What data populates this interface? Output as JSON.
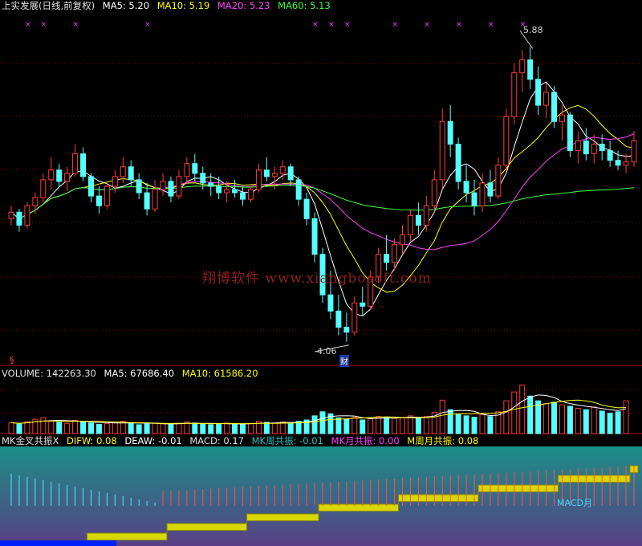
{
  "colors": {
    "up": "#ff3b3b",
    "down": "#54ffff",
    "ma5": "#ffffff",
    "ma10": "#ffff00",
    "ma20": "#ff40ff",
    "ma60": "#40ff40",
    "grid": "#8b0000",
    "frame": "#b00000",
    "label": "#d0d0d0",
    "watermark": "#8a2020",
    "macd_fill": "#d8d800",
    "blue_fill": "#0020ff"
  },
  "price_header": {
    "title": "上实发展(日线,前复权)",
    "ma5": "MA5: 5.20",
    "ma10": "MA10: 5.19",
    "ma20": "MA20: 5.23",
    "ma60": "MA60: 5.13"
  },
  "volume_header": {
    "title": "VOLUME: 142263.30",
    "ma5": "MA5: 67686.40",
    "ma10": "MA10: 61586.20"
  },
  "indicator_header": {
    "title": "MK金叉共振X",
    "difw": "DIFW: 0.08",
    "deaw": "DEAW: -0.01",
    "macd": "MACD: 0.17",
    "mk_week": "MK周共振: -0.01",
    "mk_month": "MK月共振: 0.00",
    "m_week_month": "M周月共振: 0.08"
  },
  "watermark": "翔博软件 www.xiangbosoft.com",
  "annotations": {
    "high_label": "5.88",
    "low_label": "4.06",
    "cai_badge": "财",
    "macd_month": "MACD月"
  },
  "chart_data": {
    "type": "candlestick",
    "title": "上实发展(日线,前复权)",
    "price_ylim": [
      3.92,
      6.1
    ],
    "high": 5.88,
    "low": 4.06,
    "ohlc": [
      [
        4.82,
        4.9,
        4.78,
        4.86
      ],
      [
        4.86,
        4.88,
        4.74,
        4.78
      ],
      [
        4.78,
        4.92,
        4.76,
        4.9
      ],
      [
        4.9,
        4.98,
        4.85,
        4.95
      ],
      [
        4.95,
        5.1,
        4.92,
        5.06
      ],
      [
        5.06,
        5.2,
        5.0,
        5.12
      ],
      [
        5.12,
        5.16,
        5.02,
        5.05
      ],
      [
        5.05,
        5.14,
        4.99,
        5.1
      ],
      [
        5.1,
        5.28,
        5.08,
        5.22
      ],
      [
        5.22,
        5.26,
        5.05,
        5.08
      ],
      [
        5.08,
        5.1,
        4.92,
        4.96
      ],
      [
        4.96,
        5.02,
        4.85,
        4.9
      ],
      [
        4.9,
        5.05,
        4.88,
        5.02
      ],
      [
        5.02,
        5.12,
        4.98,
        5.08
      ],
      [
        5.08,
        5.2,
        5.04,
        5.14
      ],
      [
        5.14,
        5.18,
        5.02,
        5.06
      ],
      [
        5.06,
        5.1,
        4.94,
        4.98
      ],
      [
        4.98,
        5.04,
        4.84,
        4.88
      ],
      [
        4.88,
        5.06,
        4.86,
        5.0
      ],
      [
        5.0,
        5.1,
        4.96,
        5.05
      ],
      [
        5.05,
        5.08,
        4.92,
        4.96
      ],
      [
        4.96,
        5.12,
        4.94,
        5.08
      ],
      [
        5.08,
        5.2,
        5.04,
        5.16
      ],
      [
        5.16,
        5.22,
        5.05,
        5.1
      ],
      [
        5.1,
        5.14,
        5.0,
        5.04
      ],
      [
        5.04,
        5.1,
        4.96,
        5.02
      ],
      [
        5.02,
        5.08,
        4.94,
        4.98
      ],
      [
        4.98,
        5.05,
        4.92,
        5.0
      ],
      [
        5.0,
        5.06,
        4.95,
        4.98
      ],
      [
        4.98,
        5.02,
        4.9,
        4.94
      ],
      [
        4.94,
        5.02,
        4.92,
        5.0
      ],
      [
        5.0,
        5.16,
        4.98,
        5.12
      ],
      [
        5.12,
        5.2,
        5.05,
        5.08
      ],
      [
        5.08,
        5.14,
        5.0,
        5.1
      ],
      [
        5.1,
        5.18,
        5.06,
        5.14
      ],
      [
        5.14,
        5.16,
        5.02,
        5.06
      ],
      [
        5.06,
        5.08,
        4.9,
        4.94
      ],
      [
        4.94,
        4.98,
        4.78,
        4.82
      ],
      [
        4.82,
        4.86,
        4.55,
        4.6
      ],
      [
        4.6,
        4.64,
        4.3,
        4.35
      ],
      [
        4.35,
        4.5,
        4.2,
        4.25
      ],
      [
        4.25,
        4.35,
        4.1,
        4.15
      ],
      [
        4.15,
        4.24,
        4.06,
        4.12
      ],
      [
        4.12,
        4.34,
        4.1,
        4.3
      ],
      [
        4.3,
        4.4,
        4.22,
        4.28
      ],
      [
        4.28,
        4.5,
        4.26,
        4.46
      ],
      [
        4.46,
        4.64,
        4.42,
        4.6
      ],
      [
        4.6,
        4.72,
        4.5,
        4.55
      ],
      [
        4.55,
        4.7,
        4.5,
        4.66
      ],
      [
        4.66,
        4.78,
        4.6,
        4.72
      ],
      [
        4.72,
        4.88,
        4.68,
        4.84
      ],
      [
        4.84,
        4.92,
        4.72,
        4.78
      ],
      [
        4.78,
        4.96,
        4.74,
        4.9
      ],
      [
        4.9,
        5.12,
        4.86,
        5.06
      ],
      [
        5.06,
        5.5,
        5.0,
        5.42
      ],
      [
        5.42,
        5.52,
        5.2,
        5.28
      ],
      [
        5.28,
        5.32,
        5.0,
        5.05
      ],
      [
        5.05,
        5.15,
        4.92,
        4.98
      ],
      [
        4.98,
        5.06,
        4.84,
        4.9
      ],
      [
        4.9,
        5.1,
        4.86,
        5.04
      ],
      [
        5.04,
        5.12,
        4.92,
        4.96
      ],
      [
        4.96,
        5.2,
        4.94,
        5.15
      ],
      [
        5.15,
        5.5,
        5.12,
        5.45
      ],
      [
        5.45,
        5.78,
        5.4,
        5.72
      ],
      [
        5.72,
        5.86,
        5.6,
        5.8
      ],
      [
        5.8,
        5.88,
        5.62,
        5.68
      ],
      [
        5.68,
        5.76,
        5.46,
        5.52
      ],
      [
        5.52,
        5.66,
        5.44,
        5.6
      ],
      [
        5.6,
        5.64,
        5.38,
        5.42
      ],
      [
        5.42,
        5.52,
        5.3,
        5.46
      ],
      [
        5.46,
        5.48,
        5.2,
        5.24
      ],
      [
        5.24,
        5.36,
        5.16,
        5.3
      ],
      [
        5.3,
        5.38,
        5.18,
        5.22
      ],
      [
        5.22,
        5.34,
        5.16,
        5.28
      ],
      [
        5.28,
        5.34,
        5.18,
        5.24
      ],
      [
        5.24,
        5.3,
        5.14,
        5.18
      ],
      [
        5.18,
        5.24,
        5.12,
        5.15
      ],
      [
        5.15,
        5.22,
        5.1,
        5.17
      ],
      [
        5.17,
        5.36,
        5.14,
        5.3
      ]
    ],
    "volume_ylim": [
      0,
      160000
    ],
    "volume": [
      32000,
      28000,
      35000,
      42000,
      46000,
      38000,
      33000,
      30000,
      39000,
      36000,
      31000,
      27000,
      29000,
      33000,
      36000,
      30000,
      26000,
      28000,
      31000,
      29000,
      27000,
      30000,
      34000,
      31000,
      28000,
      26000,
      29000,
      31000,
      28000,
      27000,
      30000,
      36000,
      33000,
      31000,
      34000,
      30000,
      36000,
      40000,
      52000,
      64000,
      58000,
      46000,
      42000,
      48000,
      40000,
      44000,
      50000,
      47000,
      45000,
      48000,
      52000,
      46000,
      50000,
      62000,
      98000,
      70000,
      58000,
      52000,
      48000,
      56000,
      50000,
      64000,
      96000,
      122000,
      142263,
      110000,
      96000,
      88000,
      92000,
      84000,
      80000,
      74000,
      70000,
      78000,
      66000,
      60000,
      64000,
      96000
    ],
    "indicator_labels": [
      "DIFW",
      "DEAW",
      "MACD",
      "MK周共振",
      "MK月共振",
      "M周月共振"
    ]
  }
}
